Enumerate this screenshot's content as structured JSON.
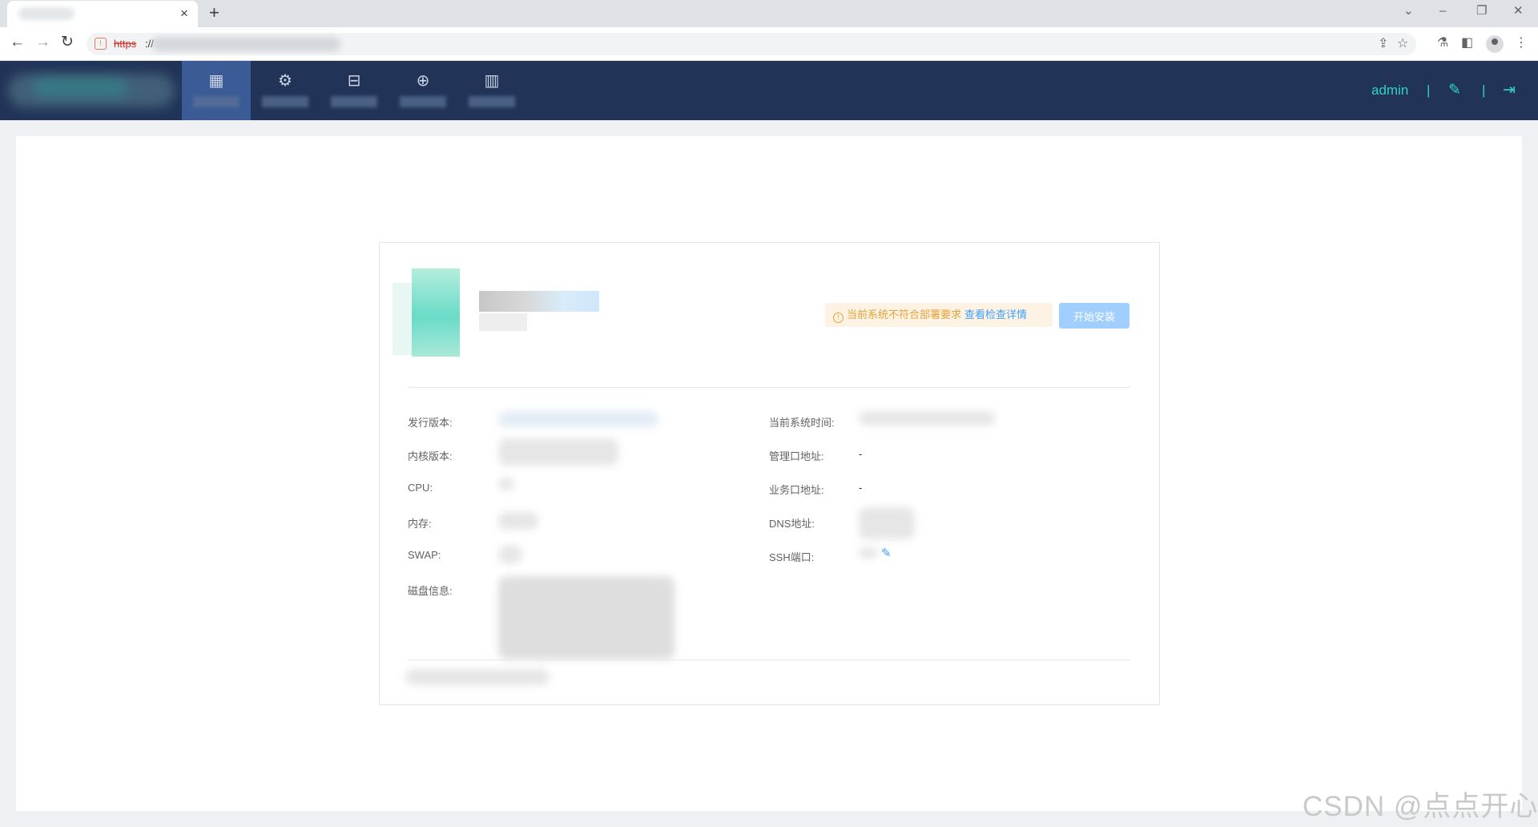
{
  "browser": {
    "tab_close": "×",
    "new_tab": "+",
    "window_controls": {
      "minimize": "–",
      "restore": "❐",
      "close": "✕",
      "tabs_menu": "⌄"
    },
    "nav": {
      "back": "←",
      "forward": "→",
      "reload": "↻"
    },
    "url_scheme": "https",
    "url_rest": "://",
    "icons": {
      "share": "⇪",
      "bookmark": "☆",
      "labs": "⚗",
      "sidepanel": "◧",
      "menu": "⋮"
    }
  },
  "header": {
    "nav_items": [
      {
        "icon": "apps-icon",
        "glyph": "▦",
        "active": true
      },
      {
        "icon": "gear-icon",
        "glyph": "⚙",
        "active": false
      },
      {
        "icon": "storage-icon",
        "glyph": "⊟",
        "active": false
      },
      {
        "icon": "globe-icon",
        "glyph": "⊕",
        "active": false
      },
      {
        "icon": "chart-icon",
        "glyph": "▥",
        "active": false
      }
    ],
    "username": "admin",
    "separator": "|",
    "edit_glyph": "✎",
    "logout_glyph": "⇥"
  },
  "card": {
    "warning": {
      "icon": "!",
      "text": "当前系统不符合部署要求",
      "link": "查看检查详情"
    },
    "install_button": "开始安装",
    "info_left": [
      {
        "label": "发行版本:",
        "value": ""
      },
      {
        "label": "内核版本:",
        "value": ""
      },
      {
        "label": "CPU:",
        "value": ""
      },
      {
        "label": "内存:",
        "value": ""
      },
      {
        "label": "SWAP:",
        "value": ""
      },
      {
        "label": "磁盘信息:",
        "value": ""
      }
    ],
    "info_right": [
      {
        "label": "当前系统时间:",
        "value": ""
      },
      {
        "label": "管理口地址:",
        "value": "-"
      },
      {
        "label": "业务口地址:",
        "value": "-"
      },
      {
        "label": "DNS地址:",
        "value": ""
      },
      {
        "label": "SSH端口:",
        "value": ""
      }
    ],
    "ssh_edit_glyph": "✎"
  },
  "watermark": "CSDN @点点开心"
}
